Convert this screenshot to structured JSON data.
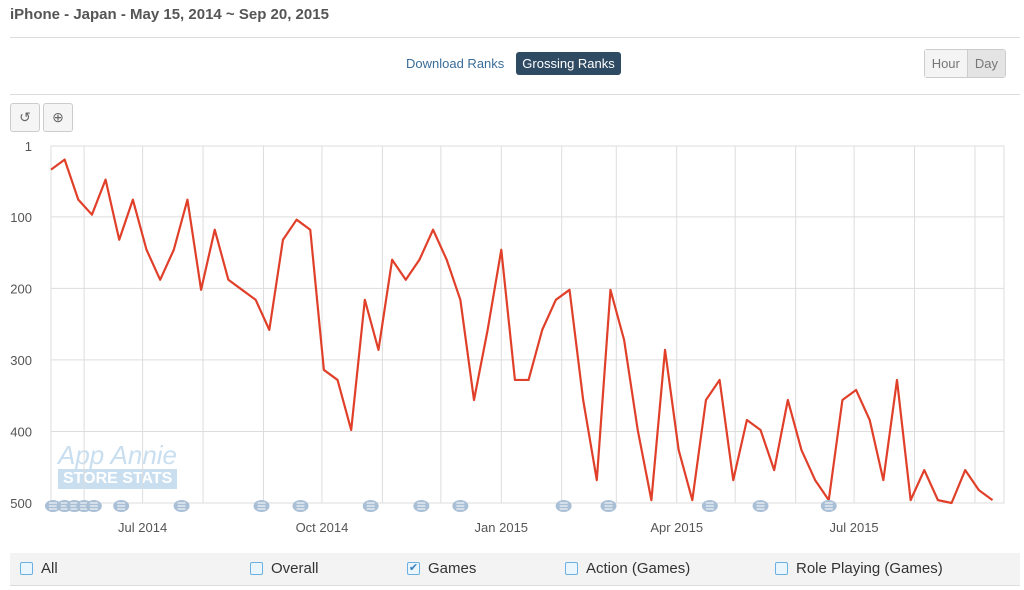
{
  "header": {
    "title": "iPhone - Japan - May 15, 2014 ~ Sep 20, 2015"
  },
  "tabs": [
    {
      "label": "Download Ranks",
      "active": false
    },
    {
      "label": "Grossing Ranks",
      "active": true
    }
  ],
  "granularity": [
    {
      "label": "Hour",
      "active": false
    },
    {
      "label": "Day",
      "active": true
    }
  ],
  "toolbar": {
    "reset": "reset-icon",
    "zoom": "zoom-in-icon"
  },
  "watermark": {
    "line1": "App Annie",
    "line2": "STORE STATS"
  },
  "legend": [
    {
      "label": "All",
      "checked": false
    },
    {
      "label": "Overall",
      "checked": false
    },
    {
      "label": "Games",
      "checked": true
    },
    {
      "label": "Action (Games)",
      "checked": false
    },
    {
      "label": "Role Playing (Games)",
      "checked": false
    }
  ],
  "chart_data": {
    "type": "line",
    "title": "",
    "xlabel": "",
    "ylabel": "",
    "y_reversed": true,
    "ylim": [
      1,
      500
    ],
    "yticks": [
      "1",
      "100",
      "200",
      "300",
      "400",
      "500"
    ],
    "xlim": [
      "2014-05-15",
      "2015-09-20"
    ],
    "xticks": [
      {
        "date": "2014-07-01",
        "label": "Jul 2014"
      },
      {
        "date": "2014-10-01",
        "label": "Oct 2014"
      },
      {
        "date": "2015-01-01",
        "label": "Jan 2015"
      },
      {
        "date": "2015-04-01",
        "label": "Apr 2015"
      },
      {
        "date": "2015-07-01",
        "label": "Jul 2015"
      }
    ],
    "grid": true,
    "color": "#e0402a",
    "series": [
      {
        "x": [
          "2014-05-15",
          "2014-05-22",
          "2014-05-29",
          "2014-06-05",
          "2014-06-12",
          "2014-06-19",
          "2014-06-26",
          "2014-07-03",
          "2014-07-10",
          "2014-07-17",
          "2014-07-24",
          "2014-07-31",
          "2014-08-07",
          "2014-08-14",
          "2014-08-21",
          "2014-08-28",
          "2014-09-04",
          "2014-09-11",
          "2014-09-18",
          "2014-09-25",
          "2014-10-02",
          "2014-10-09",
          "2014-10-16",
          "2014-10-23",
          "2014-10-30",
          "2014-11-06",
          "2014-11-13",
          "2014-11-20",
          "2014-11-27",
          "2014-12-04",
          "2014-12-11",
          "2014-12-18",
          "2014-12-25",
          "2015-01-01",
          "2015-01-08",
          "2015-01-15",
          "2015-01-22",
          "2015-01-29",
          "2015-02-05",
          "2015-02-12",
          "2015-02-19",
          "2015-02-26",
          "2015-03-05",
          "2015-03-12",
          "2015-03-19",
          "2015-03-26",
          "2015-04-02",
          "2015-04-09",
          "2015-04-16",
          "2015-04-23",
          "2015-04-30",
          "2015-05-07",
          "2015-05-14",
          "2015-05-21",
          "2015-05-28",
          "2015-06-04",
          "2015-06-11",
          "2015-06-18",
          "2015-06-25",
          "2015-07-02",
          "2015-07-09",
          "2015-07-16",
          "2015-07-23",
          "2015-07-30",
          "2015-08-06",
          "2015-08-13",
          "2015-08-20",
          "2015-08-27",
          "2015-09-03",
          "2015-09-10"
        ],
        "y": [
          34,
          20,
          76,
          97,
          48,
          132,
          76,
          146,
          188,
          146,
          76,
          202,
          118,
          188,
          202,
          216,
          258,
          132,
          104,
          118,
          314,
          328,
          398,
          216,
          286,
          160,
          188,
          160,
          118,
          160,
          216,
          356,
          258,
          146,
          328,
          328,
          258,
          216,
          202,
          356,
          468,
          202,
          272,
          398,
          496,
          286,
          426,
          496,
          356,
          328,
          468,
          384,
          398,
          454,
          356,
          426,
          468,
          496,
          356,
          342,
          384,
          468,
          328,
          496,
          454,
          496,
          500,
          454,
          482,
          496
        ]
      }
    ],
    "annotations": [
      "2014-05-16",
      "2014-05-22",
      "2014-05-27",
      "2014-06-01",
      "2014-06-06",
      "2014-06-20",
      "2014-07-21",
      "2014-08-31",
      "2014-09-20",
      "2014-10-26",
      "2014-11-21",
      "2014-12-11",
      "2015-02-02",
      "2015-02-25",
      "2015-04-18",
      "2015-05-14",
      "2015-06-18"
    ]
  }
}
